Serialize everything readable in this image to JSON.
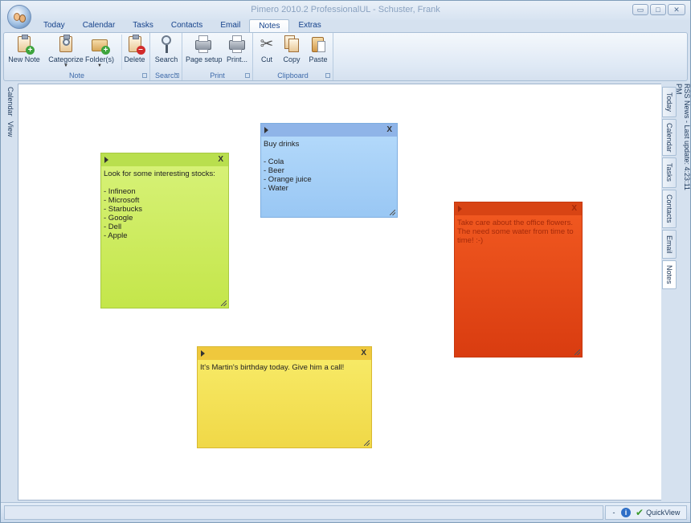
{
  "window": {
    "title": "Pimero 2010.2 ProfessionalUL - Schuster, Frank",
    "controls": {
      "minimize": "▭",
      "maximize": "□",
      "close": "✕"
    }
  },
  "menu_tabs": [
    {
      "label": "Today"
    },
    {
      "label": "Calendar"
    },
    {
      "label": "Tasks"
    },
    {
      "label": "Contacts"
    },
    {
      "label": "Email"
    },
    {
      "label": "Notes",
      "active": true
    },
    {
      "label": "Extras"
    }
  ],
  "ribbon": {
    "groups": {
      "note": {
        "label": "Note",
        "buttons": {
          "new_note": "New Note",
          "categorize": "Categorize",
          "folders": "Folder(s)",
          "delete": "Delete"
        }
      },
      "search": {
        "label": "Search",
        "buttons": {
          "search": "Search"
        }
      },
      "print": {
        "label": "Print",
        "buttons": {
          "page_setup": "Page setup",
          "print": "Print..."
        }
      },
      "clipboard": {
        "label": "Clipboard",
        "buttons": {
          "cut": "Cut",
          "copy": "Copy",
          "paste": "Paste"
        }
      }
    },
    "dropdown_glyph": "▼"
  },
  "left_side": {
    "tabs": [
      "Calendar",
      "View"
    ]
  },
  "right_side": {
    "tabs": [
      "Today",
      "Calendar",
      "Tasks",
      "Contacts",
      "Email",
      "Notes"
    ],
    "active": "Notes",
    "rss": "RSS News - Last update: 4:23:11 PM"
  },
  "notes": [
    {
      "id": "green",
      "color": "#c8e85a",
      "close": "X",
      "text": "Look for some interesting stocks:\n\n- Infineon\n- Microsoft\n- Starbucks\n- Google\n- Dell\n- Apple"
    },
    {
      "id": "blue",
      "color": "#a8d0f8",
      "close": "X",
      "text": "Buy drinks\n\n- Cola\n- Beer\n- Orange juice\n- Water"
    },
    {
      "id": "red",
      "color": "#e84a18",
      "close": "X",
      "text": "Take care about the office flowers. The need some water from time to time! :-)"
    },
    {
      "id": "yellow",
      "color": "#f4e258",
      "close": "X",
      "text": "It's Martin's birthday today. Give him a call!"
    }
  ],
  "statusbar": {
    "minus": "-",
    "info": "i",
    "check": "✔",
    "quickview": "QuickView"
  }
}
